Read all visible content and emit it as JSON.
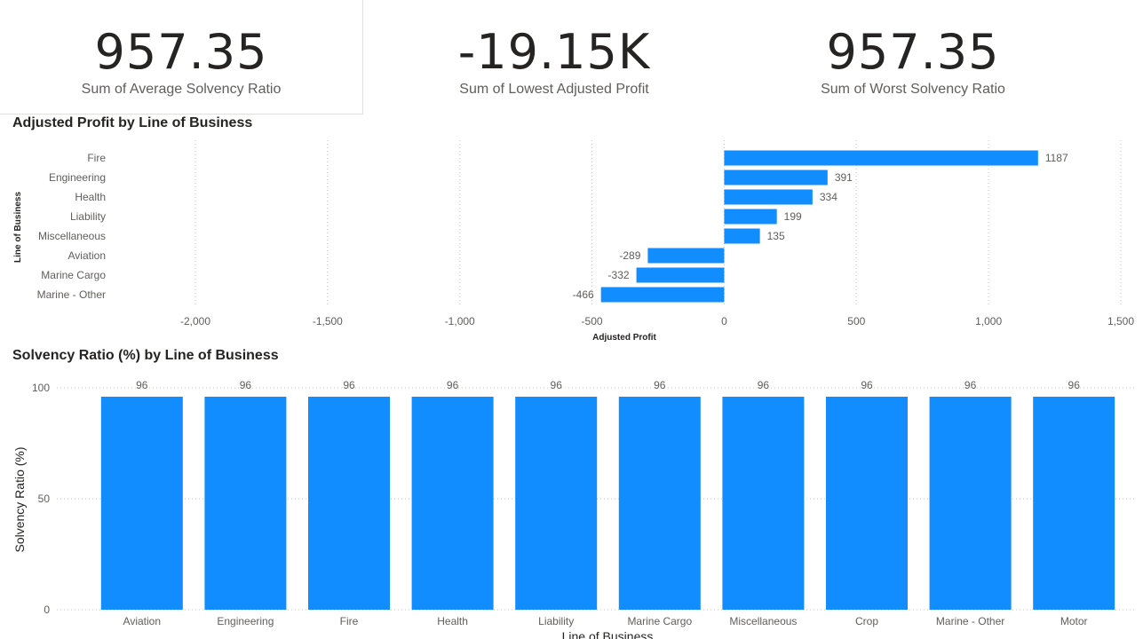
{
  "cards": [
    {
      "value": "957.35",
      "label": "Sum of Average Solvency Ratio"
    },
    {
      "value": "-19.15K",
      "label": "Sum of Lowest Adjusted Profit"
    },
    {
      "value": "957.35",
      "label": "Sum of Worst Solvency Ratio"
    }
  ],
  "colors": {
    "bar": "#118dff",
    "grid": "#c8c6c4",
    "text": "#605e5c",
    "title": "#252423"
  },
  "chart_data": [
    {
      "type": "bar",
      "orientation": "horizontal",
      "title": "Adjusted Profit by Line of Business",
      "xlabel": "Adjusted Profit",
      "ylabel": "Line of Business",
      "categories": [
        "Fire",
        "Engineering",
        "Health",
        "Liability",
        "Miscellaneous",
        "Aviation",
        "Marine Cargo",
        "Marine - Other"
      ],
      "values": [
        1187,
        391,
        334,
        199,
        135,
        -289,
        -332,
        -466
      ],
      "data_labels": [
        "1187",
        "391",
        "334",
        "199",
        "135",
        "-289",
        "-332",
        "-466"
      ],
      "xlim": [
        -2000,
        1500
      ],
      "ticks": [
        -2000,
        -1500,
        -1000,
        -500,
        0,
        500,
        1000,
        1500
      ],
      "tick_labels": [
        "-2,000",
        "-1,500",
        "-1,000",
        "-500",
        "0",
        "500",
        "1,000",
        "1,500"
      ],
      "grid": true
    },
    {
      "type": "bar",
      "orientation": "vertical",
      "title": "Solvency Ratio (%) by Line of Business",
      "xlabel": "Line of Business",
      "ylabel": "Solvency Ratio (%)",
      "categories": [
        "Aviation",
        "Engineering",
        "Fire",
        "Health",
        "Liability",
        "Marine Cargo",
        "Miscellaneous",
        "Crop",
        "Marine - Other",
        "Motor"
      ],
      "values": [
        96,
        96,
        96,
        96,
        96,
        96,
        96,
        96,
        96,
        96
      ],
      "data_labels": [
        "96",
        "96",
        "96",
        "96",
        "96",
        "96",
        "96",
        "96",
        "96",
        "96"
      ],
      "ylim": [
        0,
        100
      ],
      "ticks": [
        0,
        50,
        100
      ],
      "tick_labels": [
        "0",
        "50",
        "100"
      ],
      "grid": true
    }
  ]
}
